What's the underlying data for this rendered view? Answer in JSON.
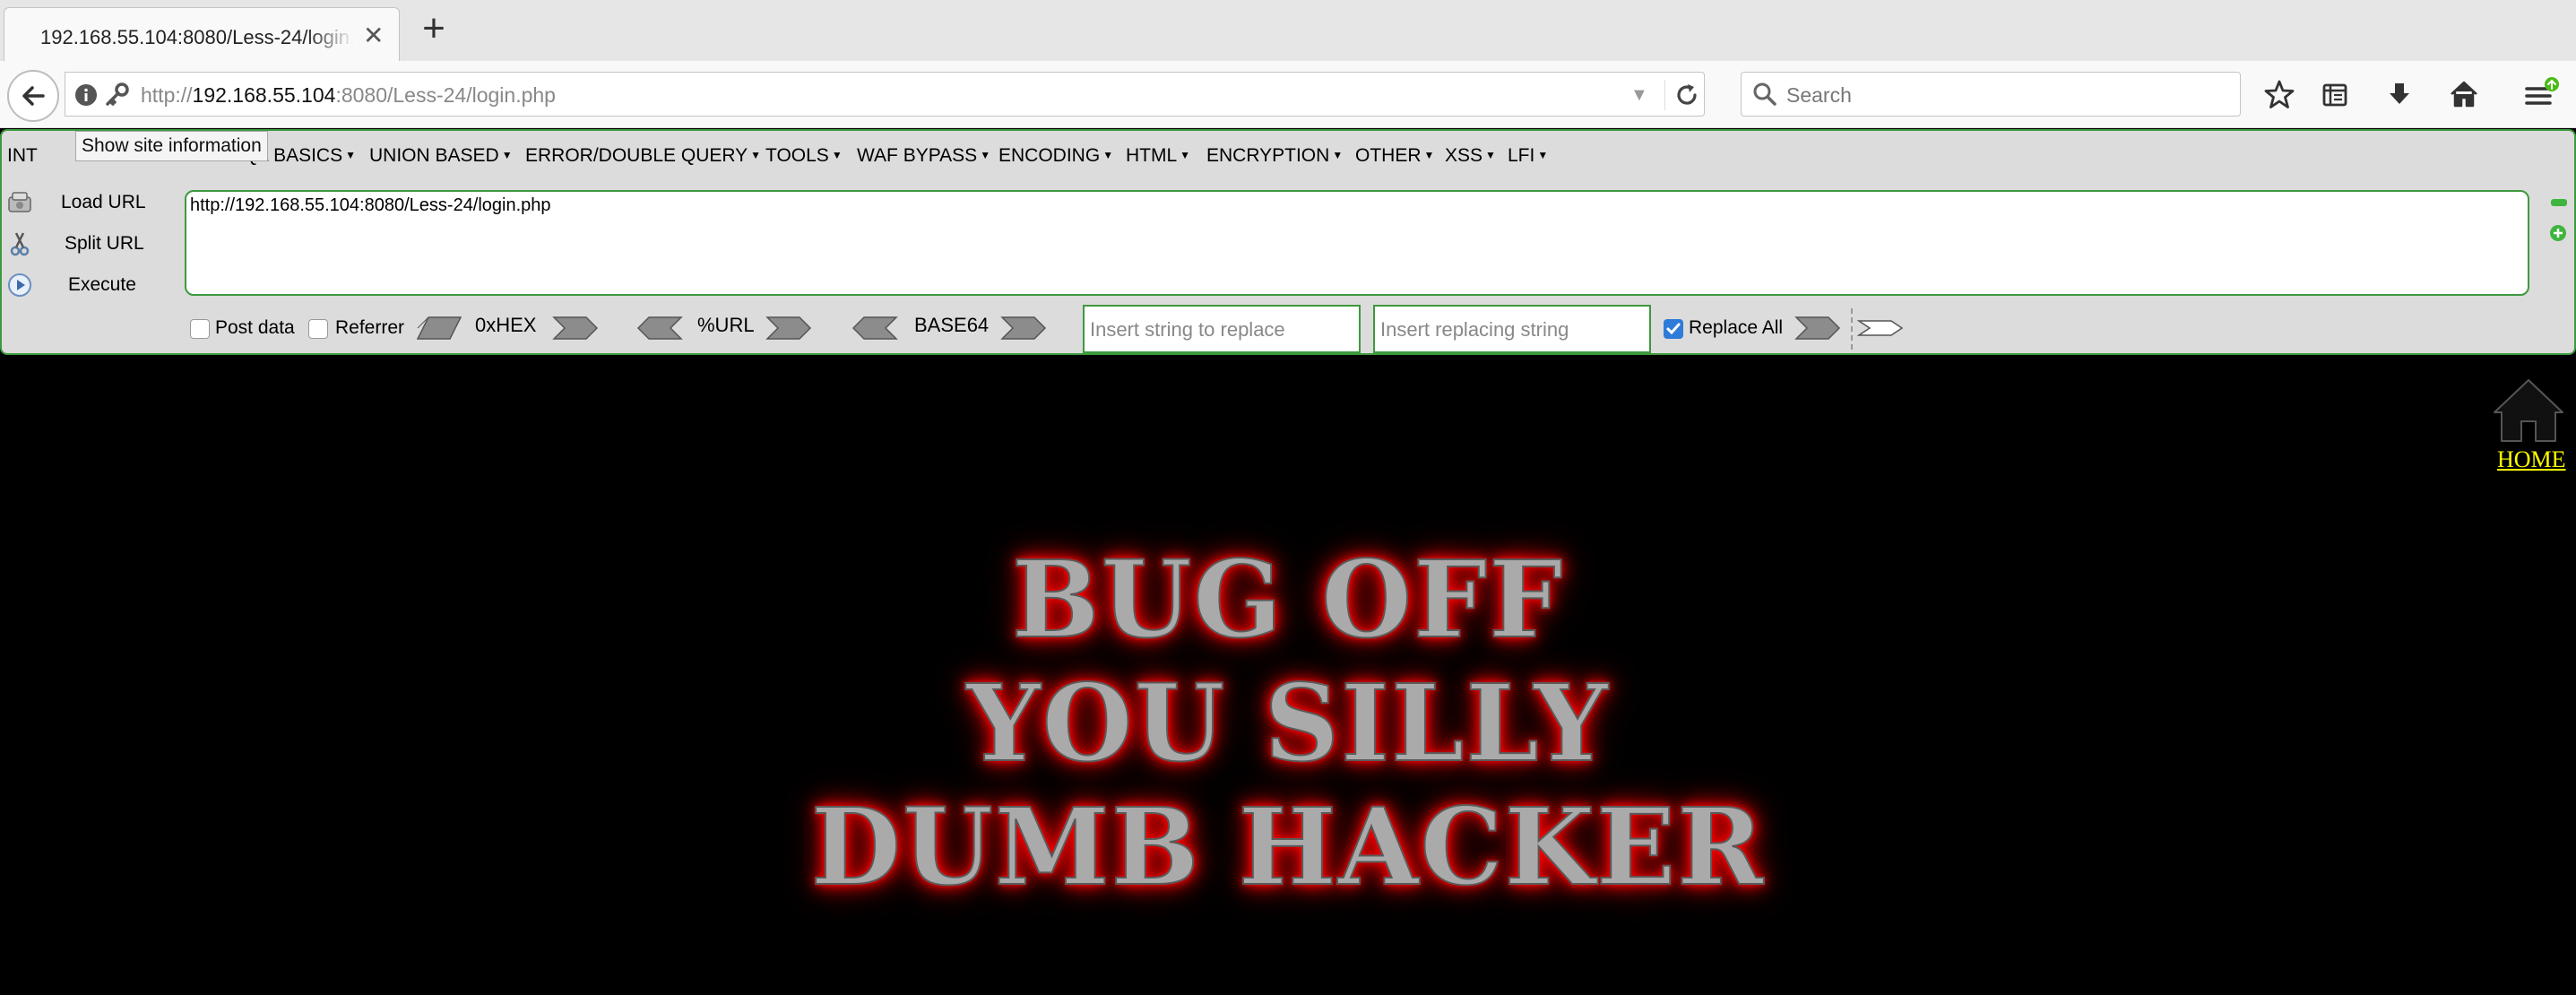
{
  "browser": {
    "tab_title": "192.168.55.104:8080/Less-24/login.php",
    "tab_close": "✕",
    "new_tab": "+",
    "url_scheme": "http://",
    "url_host": "192.168.55.104",
    "url_rest": ":8080/Less-24/login.php",
    "search_placeholder": "Search",
    "tooltip": "Show site information"
  },
  "hackbar": {
    "int_label": "INT",
    "menu": [
      "SQL BASICS",
      "UNION BASED",
      "ERROR/DOUBLE QUERY",
      "TOOLS",
      "WAF BYPASS",
      "ENCODING",
      "HTML",
      "ENCRYPTION",
      "OTHER",
      "XSS",
      "LFI"
    ],
    "load_url": "Load URL",
    "split_url": "Split URL",
    "execute": "Execute",
    "url_value": "http://192.168.55.104:8080/Less-24/login.php",
    "post_data": "Post data",
    "referrer": "Referrer",
    "hex_label": "0xHEX",
    "url_label": "%URL",
    "base64_label": "BASE64",
    "replace_placeholder": "Insert string to replace",
    "replacing_placeholder": "Insert replacing string",
    "replace_all": "Replace All",
    "post_data_checked": false,
    "referrer_checked": false,
    "replace_all_checked": true
  },
  "page": {
    "home_label": "HOME",
    "banner_lines": [
      "BUG OFF",
      "YOU SILLY",
      "DUMB HACKER"
    ],
    "banner_color": "#aaaaaa",
    "glow_color": "#ff0000",
    "home_link_color": "#ffff00"
  },
  "icons": {
    "back": "back-arrow-icon",
    "info": "info-icon",
    "key": "key-icon",
    "reload": "reload-icon",
    "search": "search-icon",
    "bookmark": "star-icon",
    "reading_list": "clipboard-icon",
    "downloads": "download-icon",
    "home": "home-icon",
    "menu": "hamburger-menu-icon"
  }
}
